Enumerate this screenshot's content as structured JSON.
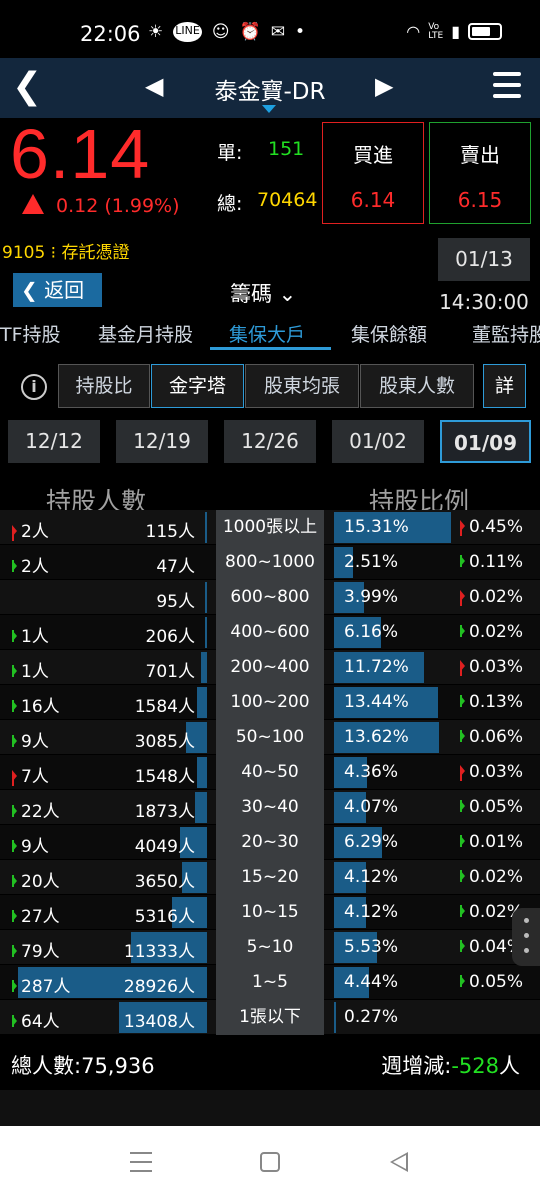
{
  "status_bar": {
    "time": "22:06",
    "icons_left": [
      "☀",
      "LINE",
      "☺",
      "⏰",
      "✉",
      "•"
    ],
    "icons_right": [
      "wifi",
      "VoLTE",
      "signal",
      "battery"
    ]
  },
  "header": {
    "title": "泰金寶-DR"
  },
  "quote": {
    "price": "6.14",
    "change": "0.12 (1.99%)",
    "single_label": "單:",
    "single_value": "151",
    "total_label": "總:",
    "total_value": "70464",
    "buy_label": "買進",
    "buy_price": "6.14",
    "sell_label": "賣出",
    "sell_price": "6.15"
  },
  "info": {
    "code": "9105 ⁝ 存託憑證",
    "datetime": "01/13 14:30:00"
  },
  "nav": {
    "back_label": "返回",
    "section": "籌碼 ⌄"
  },
  "tabs": [
    "TF持股",
    "基金月持股",
    "集保大戶",
    "集保餘額",
    "董監持股"
  ],
  "active_tab": "集保大戶",
  "views": [
    "持股比",
    "金字塔",
    "股東均張",
    "股東人數"
  ],
  "active_view": "金字塔",
  "detail_label": "詳",
  "dates": [
    "12/12",
    "12/19",
    "12/26",
    "01/02",
    "01/09"
  ],
  "active_date": "01/09",
  "columns": {
    "people": "持股人數",
    "ratio": "持股比例"
  },
  "rows": [
    {
      "pchg": "2人",
      "pdir": "up",
      "count": "115人",
      "pbar": 0.01,
      "range": "1000張以上",
      "pct": "15.31%",
      "rbar": 0.85,
      "rchg": "0.45%",
      "rdir": "up"
    },
    {
      "pchg": "2人",
      "pdir": "down",
      "count": "47人",
      "pbar": 0.0,
      "range": "800~1000",
      "pct": "2.51%",
      "rbar": 0.14,
      "rchg": "0.11%",
      "rdir": "down"
    },
    {
      "pchg": "",
      "pdir": "",
      "count": "95人",
      "pbar": 0.01,
      "range": "600~800",
      "pct": "3.99%",
      "rbar": 0.22,
      "rchg": "0.02%",
      "rdir": "up"
    },
    {
      "pchg": "1人",
      "pdir": "down",
      "count": "206人",
      "pbar": 0.01,
      "range": "400~600",
      "pct": "6.16%",
      "rbar": 0.34,
      "rchg": "0.02%",
      "rdir": "down"
    },
    {
      "pchg": "1人",
      "pdir": "down",
      "count": "701人",
      "pbar": 0.03,
      "range": "200~400",
      "pct": "11.72%",
      "rbar": 0.65,
      "rchg": "0.03%",
      "rdir": "up"
    },
    {
      "pchg": "16人",
      "pdir": "down",
      "count": "1584人",
      "pbar": 0.05,
      "range": "100~200",
      "pct": "13.44%",
      "rbar": 0.75,
      "rchg": "0.13%",
      "rdir": "down"
    },
    {
      "pchg": "9人",
      "pdir": "down",
      "count": "3085人",
      "pbar": 0.11,
      "range": "50~100",
      "pct": "13.62%",
      "rbar": 0.76,
      "rchg": "0.06%",
      "rdir": "down"
    },
    {
      "pchg": "7人",
      "pdir": "up",
      "count": "1548人",
      "pbar": 0.05,
      "range": "40~50",
      "pct": "4.36%",
      "rbar": 0.24,
      "rchg": "0.03%",
      "rdir": "up"
    },
    {
      "pchg": "22人",
      "pdir": "down",
      "count": "1873人",
      "pbar": 0.06,
      "range": "30~40",
      "pct": "4.07%",
      "rbar": 0.23,
      "rchg": "0.05%",
      "rdir": "down"
    },
    {
      "pchg": "9人",
      "pdir": "down",
      "count": "4049人",
      "pbar": 0.14,
      "range": "20~30",
      "pct": "6.29%",
      "rbar": 0.35,
      "rchg": "0.01%",
      "rdir": "down"
    },
    {
      "pchg": "20人",
      "pdir": "down",
      "count": "3650人",
      "pbar": 0.13,
      "range": "15~20",
      "pct": "4.12%",
      "rbar": 0.23,
      "rchg": "0.02%",
      "rdir": "down"
    },
    {
      "pchg": "27人",
      "pdir": "down",
      "count": "5316人",
      "pbar": 0.18,
      "range": "10~15",
      "pct": "4.12%",
      "rbar": 0.23,
      "rchg": "0.02%",
      "rdir": "down"
    },
    {
      "pchg": "79人",
      "pdir": "down",
      "count": "11333人",
      "pbar": 0.39,
      "range": "5~10",
      "pct": "5.53%",
      "rbar": 0.31,
      "rchg": "0.04%",
      "rdir": "down"
    },
    {
      "pchg": "287人",
      "pdir": "down",
      "count": "28926人",
      "pbar": 0.97,
      "range": "1~5",
      "pct": "4.44%",
      "rbar": 0.25,
      "rchg": "0.05%",
      "rdir": "down"
    },
    {
      "pchg": "64人",
      "pdir": "down",
      "count": "13408人",
      "pbar": 0.45,
      "range": "1張以下",
      "pct": "0.27%",
      "rbar": 0.01,
      "rchg": "",
      "rdir": ""
    }
  ],
  "footer": {
    "total_label": "總人數:",
    "total_value": "75,936",
    "weekly_label": "週增減:",
    "weekly_value": "-528",
    "weekly_unit": "人"
  },
  "colors": {
    "up": "#e02020",
    "down": "#22c022",
    "accent": "#2e9bd8",
    "bar": "#1a5c88"
  }
}
